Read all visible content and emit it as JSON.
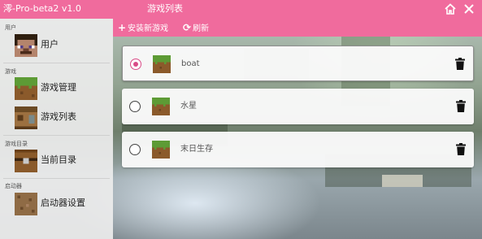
{
  "app": {
    "title": "澪-Pro-beta2 v1.0",
    "window_title": "游戏列表",
    "accent_color": "#f06b9d",
    "home_icon": "home-icon",
    "close_icon": "close-icon"
  },
  "sidebar": {
    "sections": [
      {
        "label": "用户",
        "items": [
          {
            "label": "用户",
            "icon": "steve-avatar-icon"
          }
        ]
      },
      {
        "label": "游戏",
        "items": [
          {
            "label": "游戏管理",
            "icon": "grass-block-icon"
          },
          {
            "label": "游戏列表",
            "icon": "crafting-table-icon"
          }
        ]
      },
      {
        "label": "游戏目录",
        "items": [
          {
            "label": "当前目录",
            "icon": "chest-icon"
          }
        ]
      },
      {
        "label": "启动器",
        "items": [
          {
            "label": "启动器设置",
            "icon": "dirt-block-icon"
          }
        ]
      }
    ]
  },
  "toolbar": {
    "install_label": "安装新游戏",
    "install_icon": "plus-icon",
    "refresh_label": "刷新",
    "refresh_icon": "refresh-icon"
  },
  "games": [
    {
      "name": "boat",
      "selected": true,
      "icon": "grass-block-icon",
      "action_icon": "trash-icon"
    },
    {
      "name": "水星",
      "selected": false,
      "icon": "grass-block-icon",
      "action_icon": "trash-icon"
    },
    {
      "name": "末日生存",
      "selected": false,
      "icon": "grass-block-icon",
      "action_icon": "trash-icon"
    }
  ]
}
